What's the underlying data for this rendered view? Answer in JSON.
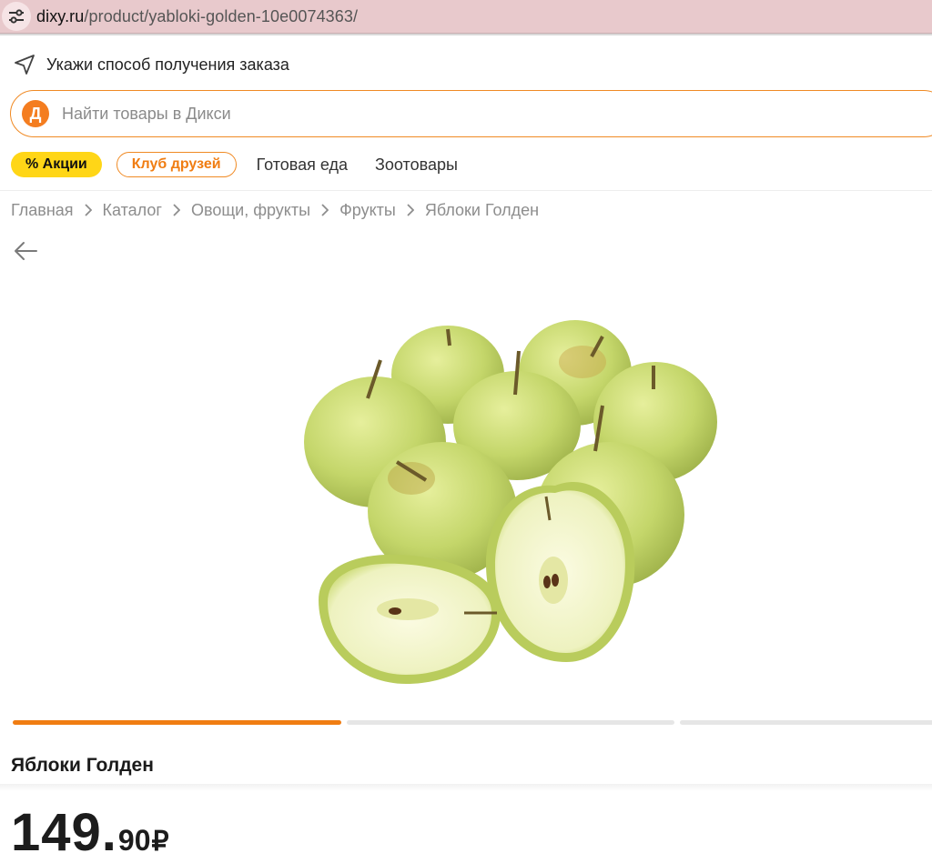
{
  "browser": {
    "url_host": "dixy.ru",
    "url_path": "/product/yabloki-golden-10e0074363/"
  },
  "delivery": {
    "label": "Укажи способ получения заказа",
    "icon": "navigation-arrow-icon"
  },
  "search": {
    "logo_letter": "Д",
    "placeholder": "Найти товары в Дикси",
    "value": ""
  },
  "nav": {
    "promo": "% Акции",
    "club": "Клуб друзей",
    "links": [
      "Готовая еда",
      "Зоотовары"
    ]
  },
  "breadcrumb": [
    "Главная",
    "Каталог",
    "Овощи, фрукты",
    "Фрукты",
    "Яблоки Голден"
  ],
  "product": {
    "title": "Яблоки Голден",
    "price_int": "149",
    "price_dot": ".",
    "price_frac": "90",
    "currency": "₽"
  },
  "carousel": {
    "slides": 3,
    "active_index": 0
  },
  "colors": {
    "accent": "#f07d12",
    "promo_yellow": "#ffd617",
    "urlbar": "#e8c9cc"
  }
}
